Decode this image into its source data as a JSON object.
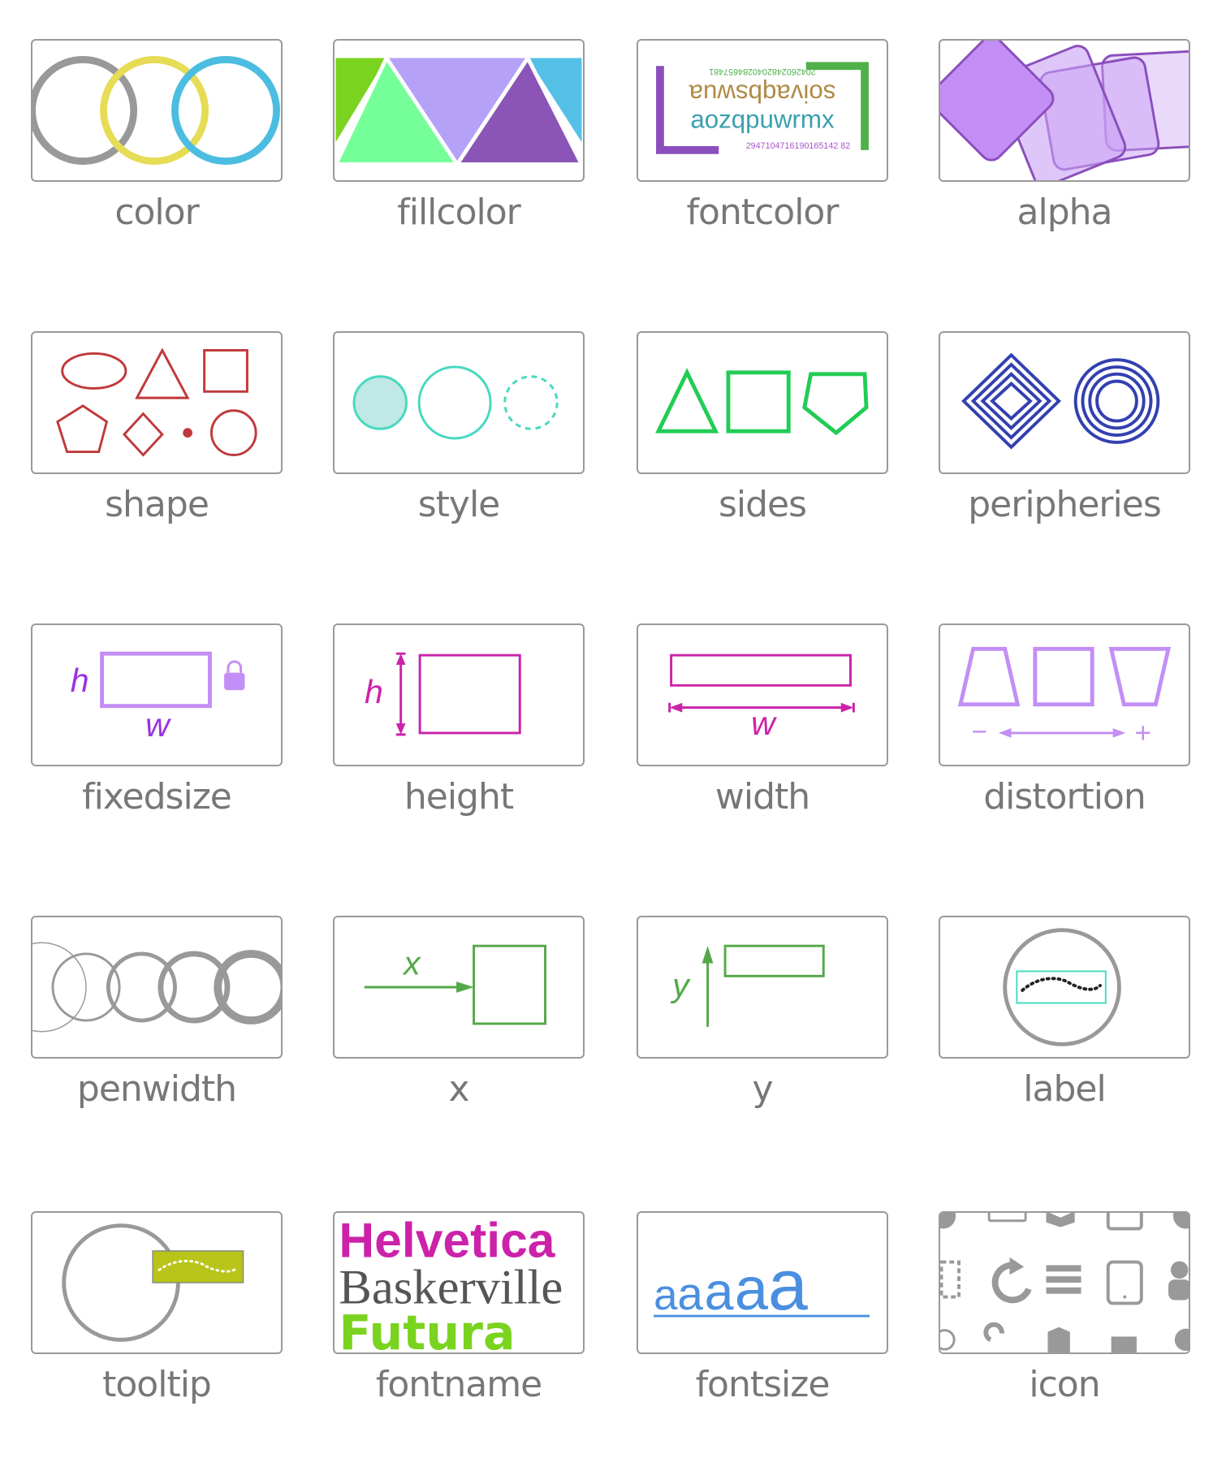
{
  "tiles": [
    {
      "id": "color",
      "label": "color"
    },
    {
      "id": "fillcolor",
      "label": "fillcolor"
    },
    {
      "id": "fontcolor",
      "label": "fontcolor"
    },
    {
      "id": "alpha",
      "label": "alpha"
    },
    {
      "id": "shape",
      "label": "shape"
    },
    {
      "id": "style",
      "label": "style"
    },
    {
      "id": "sides",
      "label": "sides"
    },
    {
      "id": "peripheries",
      "label": "peripheries"
    },
    {
      "id": "fixedsize",
      "label": "fixedsize"
    },
    {
      "id": "height",
      "label": "height"
    },
    {
      "id": "width",
      "label": "width"
    },
    {
      "id": "distortion",
      "label": "distortion"
    },
    {
      "id": "penwidth",
      "label": "penwidth"
    },
    {
      "id": "x",
      "label": "x"
    },
    {
      "id": "y",
      "label": "y"
    },
    {
      "id": "label",
      "label": "label"
    },
    {
      "id": "tooltip",
      "label": "tooltip"
    },
    {
      "id": "fontname",
      "label": "fontname"
    },
    {
      "id": "fontsize",
      "label": "fontsize"
    },
    {
      "id": "icon",
      "label": "icon"
    }
  ],
  "fontcolor_sample": {
    "line_top": "2042602482040284657481",
    "line_flipped": "soivaqbswua",
    "line_main": "aozqpuwrmx",
    "line_bottom": "2947104716190165142 82"
  },
  "fixedsize_sample": {
    "h": "h",
    "w": "w"
  },
  "height_sample": {
    "h": "h"
  },
  "width_sample": {
    "w": "w"
  },
  "distortion_sample": {
    "minus": "−",
    "plus": "+"
  },
  "x_sample": {
    "x": "x"
  },
  "y_sample": {
    "y": "y"
  },
  "fontname_sample": {
    "line1": "Helvetica",
    "line2": "Baskerville",
    "line3": "Futura"
  },
  "fontsize_sample": {
    "text": "aaaaa"
  },
  "colors": {
    "border": "#9a9a9a",
    "caption": "#777777",
    "gray": "#999999",
    "yellow": "#e6dc55",
    "cyan": "#4bbde0",
    "red": "#c0393b",
    "teal": "#46d9c0",
    "green": "#22cc55",
    "navy": "#3340b0",
    "purple": "#9a33e0",
    "magenta": "#cc22aa",
    "lavender": "#b57af0",
    "lime": "#b8c418",
    "blue": "#4a8fe0",
    "plotgreen": "#55a84a"
  }
}
